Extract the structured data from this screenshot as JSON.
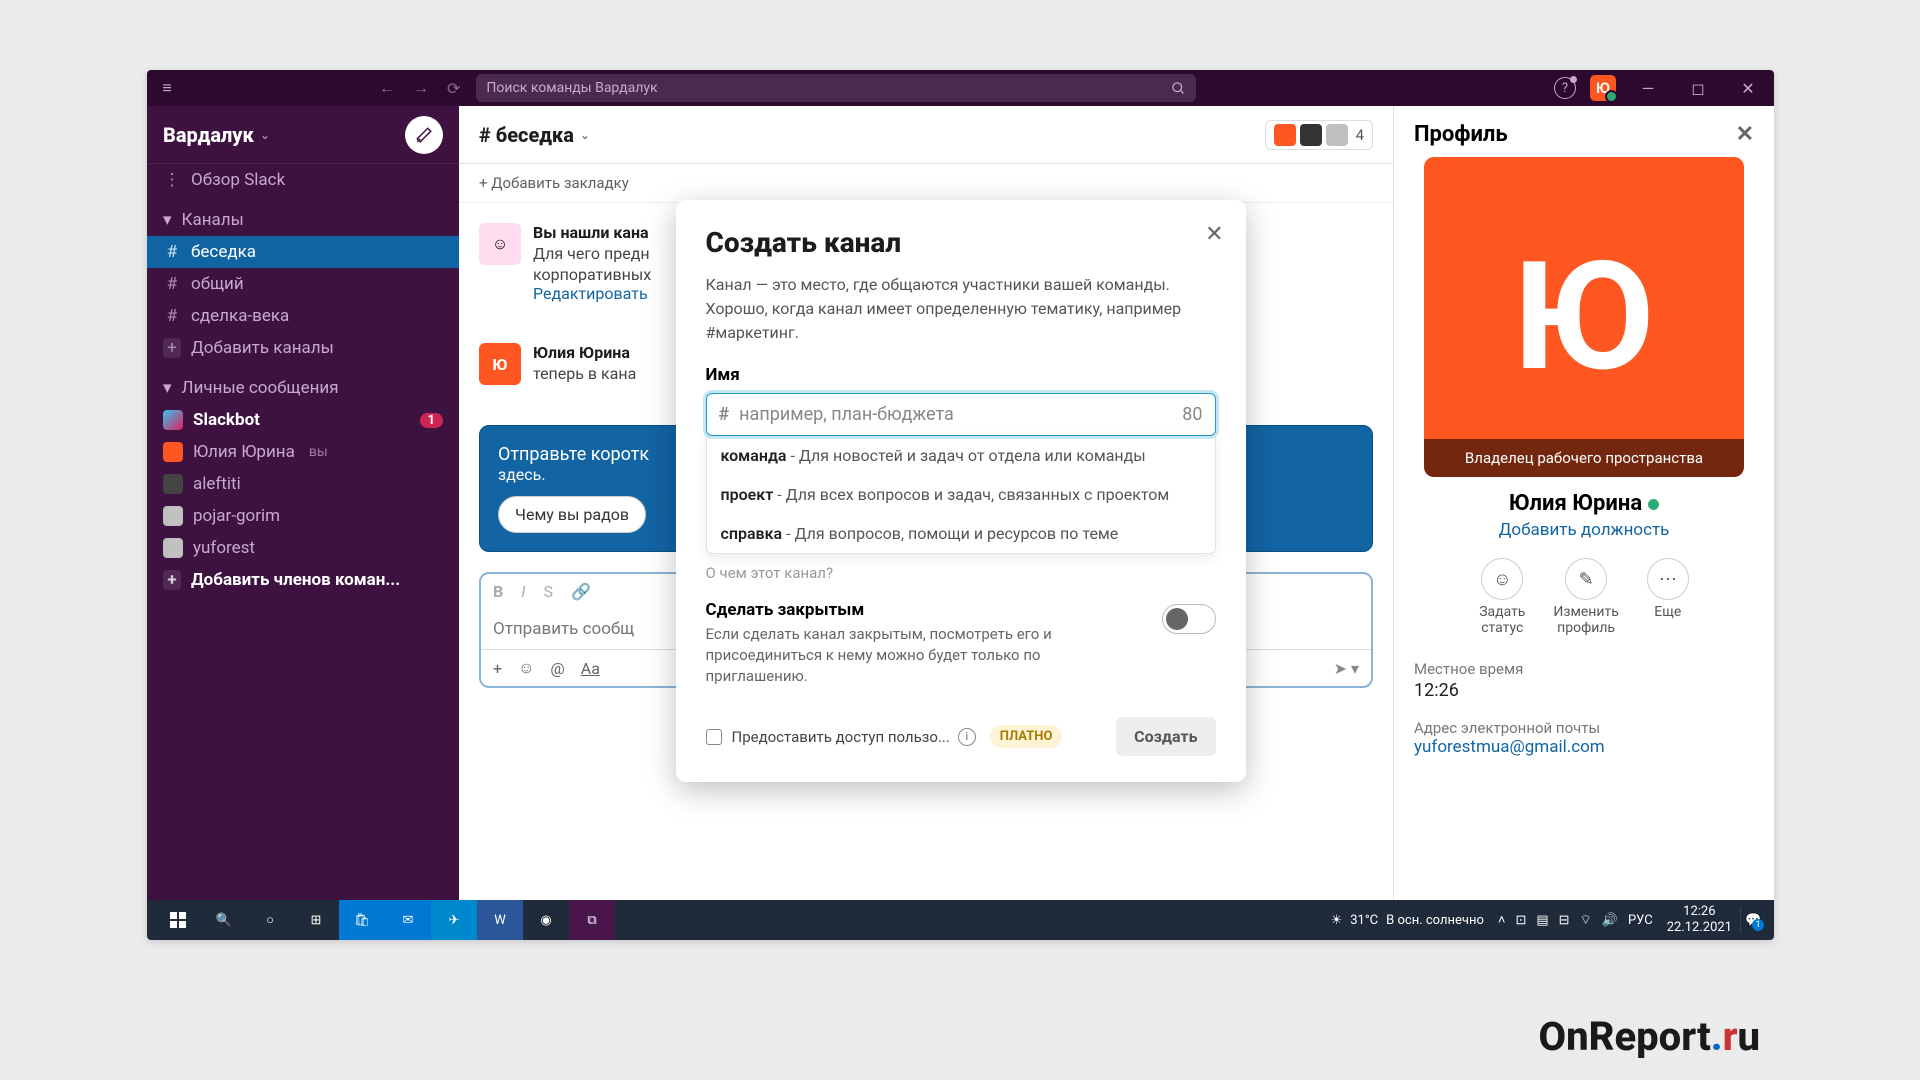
{
  "titlebar": {
    "search_placeholder": "Поиск команды Вардалук",
    "avatar_letter": "Ю"
  },
  "sidebar": {
    "workspace": "Вардалук",
    "overview": "Обзор Slack",
    "channels_label": "Каналы",
    "channels": [
      {
        "name": "беседка",
        "active": true
      },
      {
        "name": "общий"
      },
      {
        "name": "сделка-века"
      }
    ],
    "add_channels": "Добавить каналы",
    "dm_label": "Личные сообщения",
    "dms": [
      {
        "name": "Slackbot",
        "badge": "1",
        "bold": true,
        "color": "#4a154b"
      },
      {
        "name": "Юлия Юрина",
        "you": "вы",
        "color": "#ff5722"
      },
      {
        "name": "aleftiti",
        "color": "#333"
      },
      {
        "name": "pojar-gorim",
        "color": "#d0d0d0"
      },
      {
        "name": "yuforest",
        "color": "#d0d0d0"
      }
    ],
    "add_members": "Добавить членов коман..."
  },
  "channel": {
    "title": "# беседка",
    "member_count": "4",
    "add_bookmark": "+  Добавить закладку",
    "msg1": {
      "title": "Вы нашли кана",
      "l1": "Для чего предн",
      "l2": "корпоративных",
      "link": "Редактировать"
    },
    "msg2": {
      "name": "Юлия Юрина",
      "text": "теперь в кана"
    },
    "banner": {
      "title": "Отправьте коротк",
      "sub": "здесь.",
      "pill": "Чему вы радов"
    },
    "composer_placeholder": "Отправить сообщ"
  },
  "profile": {
    "header": "Профиль",
    "avatar_letter": "Ю",
    "avatar_caption": "Владелец рабочего пространства",
    "name": "Юлия Юрина",
    "add_role": "Добавить должность",
    "actions": {
      "status": "Задать\nстатус",
      "edit": "Изменить\nпрофиль",
      "more": "Еще"
    },
    "local_time_label": "Местное время",
    "local_time": "12:26",
    "email_label": "Адрес электронной почты",
    "email": "yuforestmua@gmail.com"
  },
  "modal": {
    "title": "Создать канал",
    "desc": "Канал — это место, где общаются участники вашей команды. Хорошо, когда канал имеет определенную тематику, например #маркетинг.",
    "name_label": "Имя",
    "placeholder": "например, план-бюджета",
    "counter": "80",
    "suggestions": [
      {
        "key": "команда",
        "text": " - Для новостей и задач от отдела или команды"
      },
      {
        "key": "проект",
        "text": " - Для всех вопросов и задач, связанных с проектом"
      },
      {
        "key": "справка",
        "text": " - Для вопросов, помощи и ресурсов по теме"
      }
    ],
    "about": "О чем этот канал?",
    "private_title": "Сделать закрытым",
    "private_desc": "Если сделать канал закрытым, посмотреть его и присоединиться к нему можно будет только по приглашению.",
    "share": "Предоставить доступ пользо...",
    "paid": "ПЛАТНО",
    "create": "Создать"
  },
  "taskbar": {
    "temp": "31°C",
    "weather": "В осн. солнечно",
    "lang": "РУС",
    "time": "12:26",
    "date": "22.12.2021"
  },
  "watermark": "OnReport"
}
